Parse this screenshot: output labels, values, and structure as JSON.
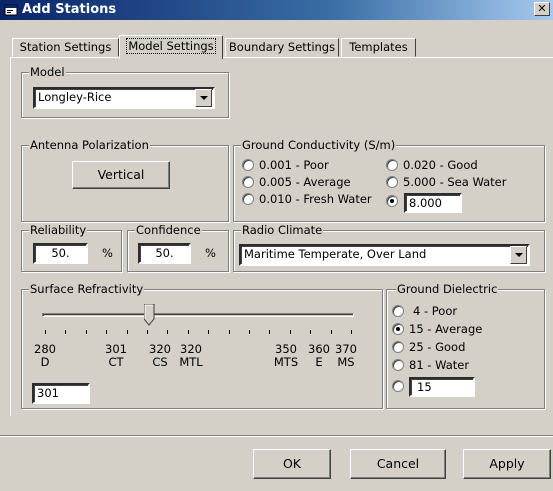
{
  "window": {
    "title": "Add Stations"
  },
  "tabs": [
    {
      "label": "Station Settings"
    },
    {
      "label": "Model Settings"
    },
    {
      "label": "Boundary Settings"
    },
    {
      "label": "Templates"
    }
  ],
  "model": {
    "group_label": "Model",
    "selected": "Longley-Rice"
  },
  "antenna": {
    "group_label": "Antenna Polarization",
    "button_label": "Vertical"
  },
  "ground_conductivity": {
    "group_label": "Ground Conductivity (S/m)",
    "options": [
      {
        "label": "0.001 - Poor"
      },
      {
        "label": "0.005 - Average"
      },
      {
        "label": "0.010 - Fresh Water"
      },
      {
        "label": "0.020 - Good"
      },
      {
        "label": "5.000 - Sea Water"
      }
    ],
    "custom_value": "8.000",
    "selected": "custom"
  },
  "reliability": {
    "group_label": "Reliability",
    "value": "50.",
    "unit": "%"
  },
  "confidence": {
    "group_label": "Confidence",
    "value": "50.",
    "unit": "%"
  },
  "radio_climate": {
    "group_label": "Radio Climate",
    "selected": "Maritime Temperate, Over Land"
  },
  "surface_refractivity": {
    "group_label": "Surface Refractivity",
    "slider_value": 301,
    "slider_min": 250,
    "slider_max": 400,
    "labels": [
      {
        "value": "280",
        "code": "D"
      },
      {
        "value": "301",
        "code": "CT"
      },
      {
        "value": "320",
        "code": "CS"
      },
      {
        "value": "320",
        "code": "MTL"
      },
      {
        "value": "350",
        "code": "MTS"
      },
      {
        "value": "360",
        "code": "E"
      },
      {
        "value": "370",
        "code": "MS"
      }
    ],
    "value": "301"
  },
  "ground_dielectric": {
    "group_label": "Ground Dielectric",
    "options": [
      {
        "label": "4 - Poor"
      },
      {
        "label": "15 - Average"
      },
      {
        "label": "25 - Good"
      },
      {
        "label": "81 - Water"
      }
    ],
    "custom_value": "15",
    "selected": "15 - Average"
  },
  "buttons": {
    "ok": "OK",
    "cancel": "Cancel",
    "apply": "Apply"
  }
}
